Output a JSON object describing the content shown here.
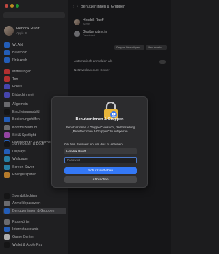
{
  "window": {
    "title": "Benutzer:innen & Gruppen"
  },
  "profile": {
    "name": "Hendrik Ruoff",
    "subtitle": "Apple ID"
  },
  "sidebar": {
    "items": [
      {
        "label": "WLAN",
        "color": "#2f7cf6"
      },
      {
        "label": "Bluetooth",
        "color": "#2f7cf6"
      },
      {
        "label": "Netzwerk",
        "color": "#2f7cf6"
      },
      {
        "label": "Mitteilungen",
        "color": "#ec4040"
      },
      {
        "label": "Ton",
        "color": "#ec4040"
      },
      {
        "label": "Fokus",
        "color": "#5e5ce6"
      },
      {
        "label": "Bildschirmzeit",
        "color": "#5e5ce6"
      },
      {
        "label": "Allgemein",
        "color": "#8e8e93"
      },
      {
        "label": "Erscheinungsbild",
        "color": "#1c1c1e"
      },
      {
        "label": "Bedienungshilfen",
        "color": "#2f7cf6"
      },
      {
        "label": "Kontrollzentrum",
        "color": "#8e8e93"
      },
      {
        "label": "Siri & Spotlight",
        "color": "#c65bd8"
      },
      {
        "label": "Datenschutz & Sicherheit",
        "color": "#2f7cf6"
      },
      {
        "label": "Schreibtisch & Dock",
        "color": "#1c1c1e"
      },
      {
        "label": "Displays",
        "color": "#2f7cf6"
      },
      {
        "label": "Wallpaper",
        "color": "#34aadc"
      },
      {
        "label": "Screen Saver",
        "color": "#34aadc"
      },
      {
        "label": "Energie sparen",
        "color": "#f2a33a"
      },
      {
        "label": "Sperrbildschirm",
        "color": "#1c1c1e"
      },
      {
        "label": "Anmeldepasswort",
        "color": "#8e8e93"
      },
      {
        "label": "Benutzer:innen & Gruppen",
        "color": "#2f7cf6",
        "selected": true
      },
      {
        "label": "Passwörter",
        "color": "#8e8e93"
      },
      {
        "label": "Internetaccounts",
        "color": "#2f7cf6"
      },
      {
        "label": "Game Center",
        "color": "#e8e8e8"
      },
      {
        "label": "Wallet & Apple Pay",
        "color": "#1c1c1e"
      }
    ]
  },
  "main": {
    "users": [
      {
        "name": "Hendrik Ruoff",
        "sub": "Admin"
      },
      {
        "name": "Gastbenutzer:in",
        "sub": "Deaktiviert"
      }
    ],
    "buttons": [
      "Gruppe hinzufügen ...",
      "Benutzer:in ..."
    ],
    "auto_login_label": "Automatisch anmelden als",
    "network_server_label": "Netzwerkaccount-Server"
  },
  "dialog": {
    "title": "Benutzer:innen & Gruppen",
    "message": "„Benutzer:innen & Gruppen“ versucht, die Einstellung „Benutzer:innen & Gruppen“ zu entsperren.",
    "prompt": "Gib dein Passwort ein, um dies zu erlauben.",
    "username_value": "Hendrik Ruoff",
    "password_placeholder": "Passwort",
    "primary_button": "Schutz aufheben",
    "cancel_button": "Abbrechen"
  }
}
